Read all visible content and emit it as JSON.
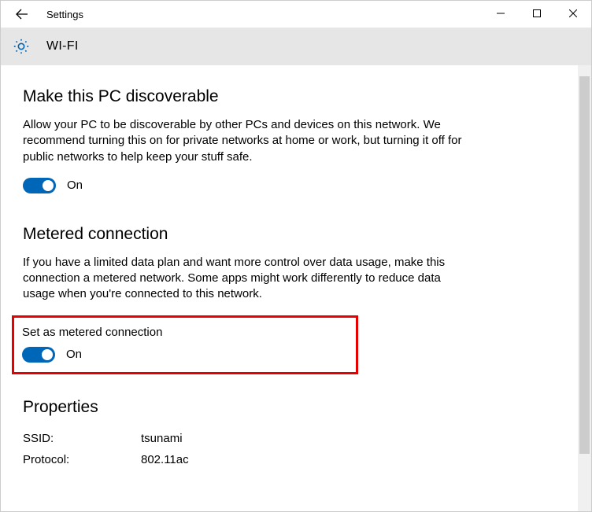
{
  "titlebar": {
    "title": "Settings"
  },
  "header": {
    "label": "WI-FI"
  },
  "discoverable": {
    "heading": "Make this PC discoverable",
    "desc": "Allow your PC to be discoverable by other PCs and devices on this network. We recommend turning this on for private networks at home or work, but turning it off for public networks to help keep your stuff safe.",
    "state": "On"
  },
  "metered": {
    "heading": "Metered connection",
    "desc": "If you have a limited data plan and want more control over data usage, make this connection a metered network. Some apps might work differently to reduce data usage when you're connected to this network.",
    "sublabel": "Set as metered connection",
    "state": "On"
  },
  "properties": {
    "heading": "Properties",
    "ssid_label": "SSID:",
    "ssid_value": "tsunami",
    "protocol_label": "Protocol:",
    "protocol_value": "802.11ac"
  }
}
